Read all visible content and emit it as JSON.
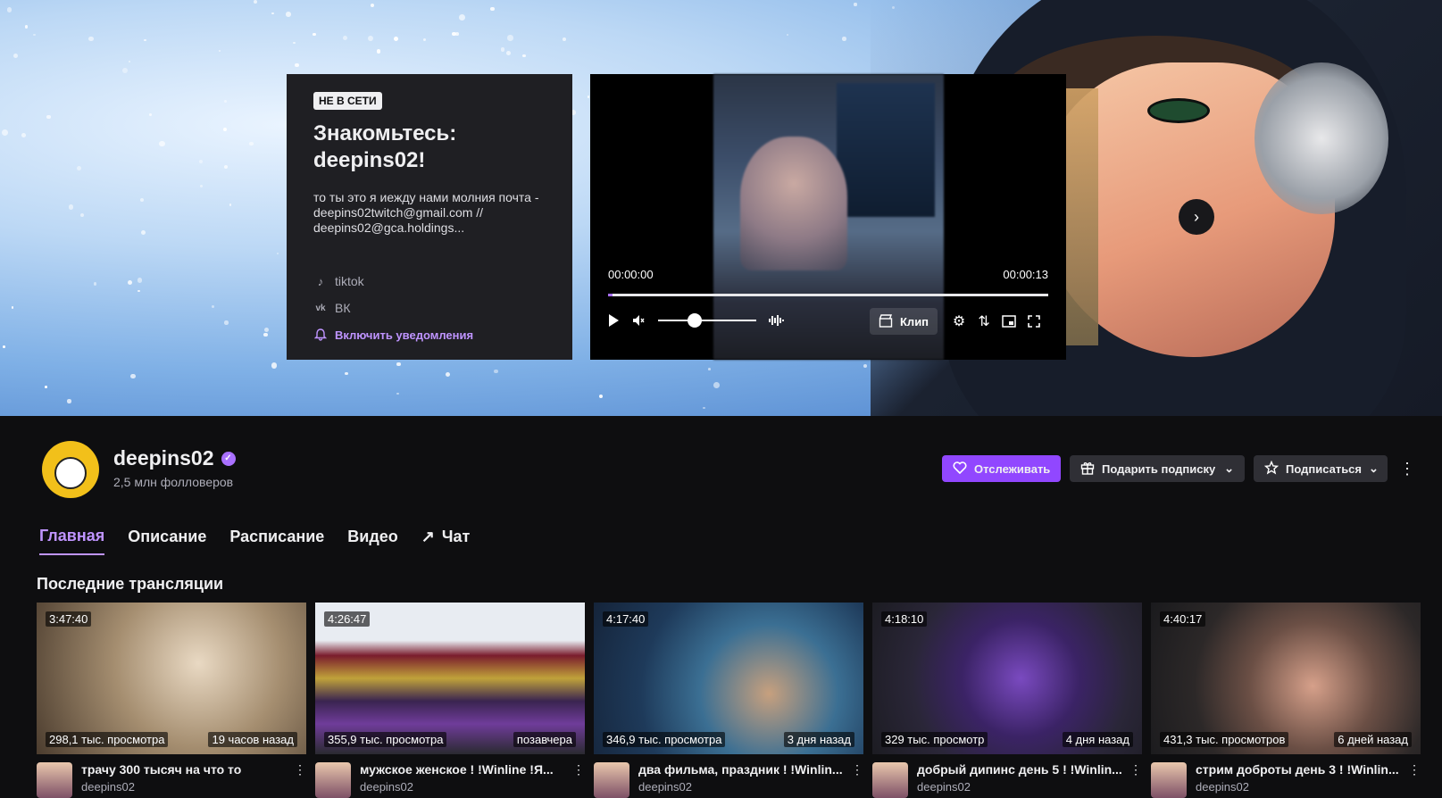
{
  "banner": {
    "status_badge": "НЕ В СЕТИ",
    "title": "Знакомьтесь: deepins02!",
    "description": "то ты это я иежду нами молния почта - deepins02twitch@gmail.com // deepins02@gca.holdings...",
    "socials": [
      {
        "label": "tiktok",
        "icon": "tiktok-icon"
      },
      {
        "label": "ВК",
        "icon": "vk-icon"
      }
    ],
    "notify_label": "Включить уведомления"
  },
  "player": {
    "time_current": "00:00:00",
    "time_total": "00:00:13",
    "progress": 0.01,
    "volume": 0.3,
    "clip_label": "Клип"
  },
  "channel": {
    "name": "deepins02",
    "followers": "2,5 млн фолловеров",
    "follow_label": "Отслеживать",
    "gift_label": "Подарить подписку",
    "subscribe_label": "Подписаться"
  },
  "tabs": [
    {
      "label": "Главная",
      "active": true
    },
    {
      "label": "Описание"
    },
    {
      "label": "Расписание"
    },
    {
      "label": "Видео"
    },
    {
      "label": "Чат",
      "icon": "external-arrow-icon"
    }
  ],
  "section_title": "Последние трансляции",
  "videos": [
    {
      "duration": "3:47:40",
      "views": "298,1 тыс. просмотра",
      "ago": "19 часов назад",
      "title": "трачу 300 тысяч на что то",
      "channel": "deepins02"
    },
    {
      "duration": "4:26:47",
      "views": "355,9 тыс. просмотра",
      "ago": "позавчера",
      "title": "мужское женское ! !Winline !Я...",
      "channel": "deepins02"
    },
    {
      "duration": "4:17:40",
      "views": "346,9 тыс. просмотра",
      "ago": "3 дня назад",
      "title": "два фильма, праздник ! !Winlin...",
      "channel": "deepins02"
    },
    {
      "duration": "4:18:10",
      "views": "329 тыс. просмотр",
      "ago": "4 дня назад",
      "title": "добрый дипинс день 5 ! !Winlin...",
      "channel": "deepins02"
    },
    {
      "duration": "4:40:17",
      "views": "431,3 тыс. просмотров",
      "ago": "6 дней назад",
      "title": "стрим доброты день 3 ! !Winlin...",
      "channel": "deepins02"
    }
  ],
  "colors": {
    "accent": "#9147ff",
    "accent_text": "#bf94ff",
    "bg": "#0e0e10"
  }
}
